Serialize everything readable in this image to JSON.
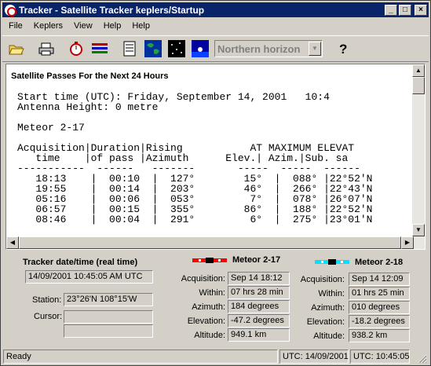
{
  "window": {
    "title": "Tracker - Satellite Tracker  keplers/Startup"
  },
  "menu": [
    "File",
    "Keplers",
    "View",
    "Help",
    "Help"
  ],
  "toolbar": {
    "horizon_select": "Northern horizon"
  },
  "report": {
    "heading": "Satellite Passes For the Next 24 Hours",
    "start_time": "Start time (UTC): Friday, September 14, 2001   10:4",
    "antenna": "Antenna Height: 0 metre",
    "satellite": "Meteor 2-17",
    "header1": "Acquisition|Duration|Rising           AT MAXIMUM ELEVAT",
    "header2": "   time    |of pass |Azimuth      Elev.| Azim.|Sub. sa",
    "separator": "-----------  ------   -------       -----  -----  ------",
    "rows": [
      "   18:13    |  00:10  |  127°        15°  |  088° |22°52'N",
      "   19:55    |  00:14  |  203°        46°  |  266° |22°43'N",
      "   05:16    |  00:06  |  053°         7°  |  078° |26°07'N",
      "   06:57    |  00:15  |  355°        86°  |  188° |22°52'N",
      "   08:46    |  00:04  |  291°         6°  |  275° |23°01'N"
    ]
  },
  "tracker": {
    "heading": "Tracker date/time (real time)",
    "datetime": "14/09/2001 10:45:05 AM UTC",
    "station_label": "Station:",
    "station": "23°26'N   108°15'W",
    "cursor_label": "Cursor:",
    "cursor": "",
    "cursor2": ""
  },
  "sat_labels": {
    "acquisition": "Acquisition:",
    "within": "Within:",
    "azimuth": "Azimuth:",
    "elevation": "Elevation:",
    "altitude": "Altitude:"
  },
  "sat1": {
    "name": "Meteor 2-17",
    "acquisition": "Sep 14  18:12",
    "within": "07 hrs 28 min",
    "azimuth": "184 degrees",
    "elevation": "-47.2 degrees",
    "altitude": "949.1 km",
    "color": "#ff0000"
  },
  "sat2": {
    "name": "Meteor 2-18",
    "acquisition": "Sep 14  12:09",
    "within": "01 hrs 25 min",
    "azimuth": "010 degrees",
    "elevation": "-18.2 degrees",
    "altitude": "938.2 km",
    "color": "#00e0ff"
  },
  "status": {
    "ready": "Ready",
    "utc_date": "UTC: 14/09/2001",
    "utc_time": "UTC: 10:45:05"
  }
}
